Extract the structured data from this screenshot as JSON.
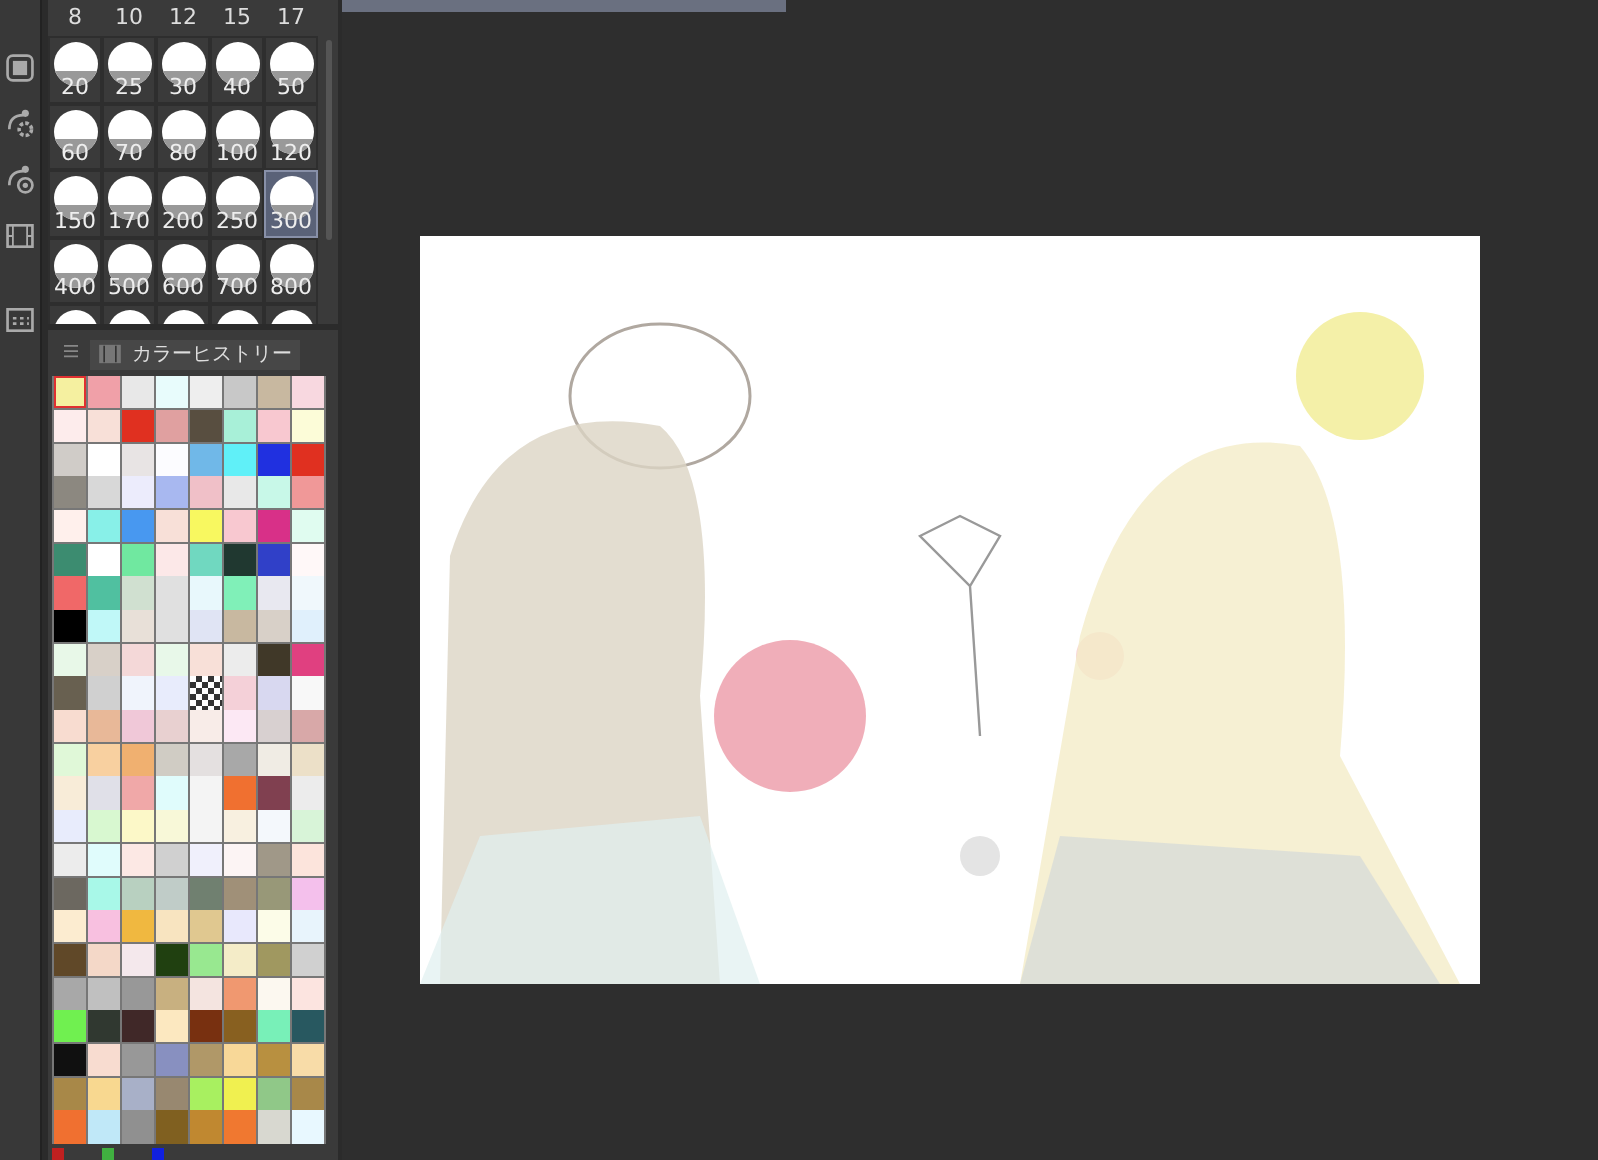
{
  "brush_sizes": {
    "top_row": [
      "8",
      "10",
      "12",
      "15",
      "17"
    ],
    "items": [
      {
        "label": "20",
        "selected": false
      },
      {
        "label": "25",
        "selected": false
      },
      {
        "label": "30",
        "selected": false
      },
      {
        "label": "40",
        "selected": false
      },
      {
        "label": "50",
        "selected": false
      },
      {
        "label": "60",
        "selected": false
      },
      {
        "label": "70",
        "selected": false
      },
      {
        "label": "80",
        "selected": false
      },
      {
        "label": "100",
        "selected": false
      },
      {
        "label": "120",
        "selected": false
      },
      {
        "label": "150",
        "selected": false
      },
      {
        "label": "170",
        "selected": false
      },
      {
        "label": "200",
        "selected": false
      },
      {
        "label": "250",
        "selected": false
      },
      {
        "label": "300",
        "selected": true
      },
      {
        "label": "400",
        "selected": false
      },
      {
        "label": "500",
        "selected": false
      },
      {
        "label": "600",
        "selected": false
      },
      {
        "label": "700",
        "selected": false
      },
      {
        "label": "800",
        "selected": false
      }
    ]
  },
  "color_history": {
    "tab": "カラーヒストリー",
    "rows": [
      [
        {
          "kind": "color",
          "color": "#f5f0a0",
          "selected": true
        },
        {
          "kind": "color",
          "color": "#f0a0a8",
          "selected": false
        },
        {
          "kind": "color",
          "color": "#e8e8e8",
          "selected": false
        },
        {
          "kind": "color",
          "color": "#e8fcfc",
          "selected": false
        },
        {
          "kind": "color",
          "color": "#eeeeee",
          "selected": false
        },
        {
          "kind": "color",
          "color": "#c8c8c8",
          "selected": false
        },
        {
          "kind": "color",
          "color": "#c8b8a0",
          "selected": false
        },
        {
          "kind": "color",
          "color": "#f8d8e0",
          "selected": false
        }
      ],
      [
        {
          "kind": "color",
          "color": "#fdecec",
          "selected": false
        },
        {
          "kind": "color",
          "color": "#f8e0d8",
          "selected": false
        },
        {
          "kind": "color",
          "color": "#e03020",
          "selected": false
        },
        {
          "kind": "color",
          "color": "#e0a0a0",
          "selected": false
        },
        {
          "kind": "color",
          "color": "#584e40",
          "selected": false
        },
        {
          "kind": "color",
          "color": "#a8f0d8",
          "selected": false
        },
        {
          "kind": "color",
          "color": "#f8c8d0",
          "selected": false
        },
        {
          "kind": "color",
          "color": "#fcfcd8",
          "selected": false
        }
      ],
      [
        {
          "kind": "color",
          "color": "#d0ccc8",
          "selected": false
        },
        {
          "kind": "color",
          "color": "#ffffff",
          "selected": false
        },
        {
          "kind": "color",
          "color": "#e8e4e4",
          "selected": false
        },
        {
          "kind": "color",
          "color": "#fcfcff",
          "selected": false
        },
        {
          "kind": "color",
          "color": "#70b8e8",
          "selected": false
        },
        {
          "kind": "color",
          "color": "#60f0f8",
          "selected": false
        },
        {
          "kind": "color",
          "color": "#2030e0",
          "selected": false
        },
        {
          "kind": "color",
          "color": "#e03020",
          "selected": false
        }
      ],
      [
        {
          "kind": "color",
          "color": "#8c8880",
          "selected": false
        },
        {
          "kind": "color",
          "color": "#d8d8d8",
          "selected": false
        },
        {
          "kind": "color",
          "color": "#ececfc",
          "selected": false
        },
        {
          "kind": "color",
          "color": "#a8b8f0",
          "selected": false
        },
        {
          "kind": "color",
          "color": "#f0c0c8",
          "selected": false
        },
        {
          "kind": "color",
          "color": "#e8e8e8",
          "selected": false
        },
        {
          "kind": "color",
          "color": "#c8f8e8",
          "selected": false
        },
        {
          "kind": "color",
          "color": "#f09898",
          "selected": false
        }
      ],
      [
        {
          "kind": "color",
          "color": "#fff0ec",
          "selected": false
        },
        {
          "kind": "color",
          "color": "#88f0e8",
          "selected": false
        },
        {
          "kind": "color",
          "color": "#4898f0",
          "selected": false
        },
        {
          "kind": "color",
          "color": "#f8e0d8",
          "selected": false
        },
        {
          "kind": "color",
          "color": "#f8f860",
          "selected": false
        },
        {
          "kind": "color",
          "color": "#f8c8d0",
          "selected": false
        },
        {
          "kind": "color",
          "color": "#d83088",
          "selected": false
        },
        {
          "kind": "color",
          "color": "#e0fcf0",
          "selected": false
        }
      ],
      [
        {
          "kind": "color",
          "color": "#3c8c70",
          "selected": false
        },
        {
          "kind": "color",
          "color": "#ffffff",
          "selected": false
        },
        {
          "kind": "color",
          "color": "#70e8a0",
          "selected": false
        },
        {
          "kind": "color",
          "color": "#fce8e8",
          "selected": false
        },
        {
          "kind": "color",
          "color": "#70d8c0",
          "selected": false
        },
        {
          "kind": "color",
          "color": "#203830",
          "selected": false
        },
        {
          "kind": "color",
          "color": "#3040c8",
          "selected": false
        },
        {
          "kind": "color",
          "color": "#fff8f8",
          "selected": false
        }
      ],
      [
        {
          "kind": "color",
          "color": "#f06868",
          "selected": false
        },
        {
          "kind": "color",
          "color": "#50c0a0",
          "selected": false
        },
        {
          "kind": "color",
          "color": "#d0e0d0",
          "selected": false
        },
        {
          "kind": "color",
          "color": "#e0e0e0",
          "selected": false
        },
        {
          "kind": "color",
          "color": "#e8f8fc",
          "selected": false
        },
        {
          "kind": "color",
          "color": "#80f0b8",
          "selected": false
        },
        {
          "kind": "color",
          "color": "#e8e8f0",
          "selected": false
        },
        {
          "kind": "color",
          "color": "#f0f8fc",
          "selected": false
        }
      ],
      [
        {
          "kind": "color",
          "color": "#000000",
          "selected": false
        },
        {
          "kind": "color",
          "color": "#c0f8f8",
          "selected": false
        },
        {
          "kind": "color",
          "color": "#e8e0d8",
          "selected": false
        },
        {
          "kind": "color",
          "color": "#e0e0e0",
          "selected": false
        },
        {
          "kind": "color",
          "color": "#e0e4f4",
          "selected": false
        },
        {
          "kind": "color",
          "color": "#c8b8a0",
          "selected": false
        },
        {
          "kind": "color",
          "color": "#d8d0c8",
          "selected": false
        },
        {
          "kind": "color",
          "color": "#e0f0fc",
          "selected": false
        }
      ],
      [
        {
          "kind": "color",
          "color": "#e8f8e8",
          "selected": false
        },
        {
          "kind": "color",
          "color": "#d8d0c8",
          "selected": false
        },
        {
          "kind": "color",
          "color": "#f4d8d8",
          "selected": false
        },
        {
          "kind": "color",
          "color": "#e8f8e9",
          "selected": false
        },
        {
          "kind": "color",
          "color": "#f8e0d8",
          "selected": false
        },
        {
          "kind": "color",
          "color": "#ececec",
          "selected": false
        },
        {
          "kind": "color",
          "color": "#403828",
          "selected": false
        },
        {
          "kind": "color",
          "color": "#e04080",
          "selected": false
        }
      ],
      [
        {
          "kind": "color",
          "color": "#686050",
          "selected": false
        },
        {
          "kind": "color",
          "color": "#d0d0d0",
          "selected": false
        },
        {
          "kind": "color",
          "color": "#f0f4fc",
          "selected": false
        },
        {
          "kind": "color",
          "color": "#e8ecfc",
          "selected": false
        },
        {
          "kind": "transparent",
          "selected": false
        },
        {
          "kind": "color",
          "color": "#f4d0d8",
          "selected": false
        },
        {
          "kind": "color",
          "color": "#d8d8f0",
          "selected": false
        },
        {
          "kind": "color",
          "color": "#f8f8f8",
          "selected": false
        }
      ],
      [
        {
          "kind": "color",
          "color": "#f8dcd0",
          "selected": false
        },
        {
          "kind": "color",
          "color": "#e8b898",
          "selected": false
        },
        {
          "kind": "color",
          "color": "#f0c8d8",
          "selected": false
        },
        {
          "kind": "color",
          "color": "#e8d0d0",
          "selected": false
        },
        {
          "kind": "color",
          "color": "#f8ece8",
          "selected": false
        },
        {
          "kind": "color",
          "color": "#fce8f4",
          "selected": false
        },
        {
          "kind": "color",
          "color": "#d8d0d0",
          "selected": false
        },
        {
          "kind": "color",
          "color": "#d8a8a8",
          "selected": false
        }
      ],
      [
        {
          "kind": "color",
          "color": "#e0f8d8",
          "selected": false
        },
        {
          "kind": "color",
          "color": "#f8d0a0",
          "selected": false
        },
        {
          "kind": "color",
          "color": "#f0b070",
          "selected": false
        },
        {
          "kind": "color",
          "color": "#d0ccc4",
          "selected": false
        },
        {
          "kind": "color",
          "color": "#e4e0e0",
          "selected": false
        },
        {
          "kind": "color",
          "color": "#a8a8a8",
          "selected": false
        },
        {
          "kind": "color",
          "color": "#f0ece4",
          "selected": false
        },
        {
          "kind": "color",
          "color": "#ece0c8",
          "selected": false
        }
      ],
      [
        {
          "kind": "color",
          "color": "#f8ecd8",
          "selected": false
        },
        {
          "kind": "color",
          "color": "#e0e0e8",
          "selected": false
        },
        {
          "kind": "color",
          "color": "#f0a8a8",
          "selected": false
        },
        {
          "kind": "color",
          "color": "#e0fcfc",
          "selected": false
        },
        {
          "kind": "color",
          "color": "#f4f4f4",
          "selected": false
        },
        {
          "kind": "color",
          "color": "#f07030",
          "selected": false
        },
        {
          "kind": "color",
          "color": "#804050",
          "selected": false
        },
        {
          "kind": "color",
          "color": "#ececec",
          "selected": false
        }
      ],
      [
        {
          "kind": "color",
          "color": "#e8ecfc",
          "selected": false
        },
        {
          "kind": "color",
          "color": "#d8f8d0",
          "selected": false
        },
        {
          "kind": "color",
          "color": "#fcf8c8",
          "selected": false
        },
        {
          "kind": "color",
          "color": "#f8f8d8",
          "selected": false
        },
        {
          "kind": "color",
          "color": "#f4f4f4",
          "selected": false
        },
        {
          "kind": "color",
          "color": "#f8f0e0",
          "selected": false
        },
        {
          "kind": "color",
          "color": "#f4f8fc",
          "selected": false
        },
        {
          "kind": "color",
          "color": "#d8f4d8",
          "selected": false
        }
      ],
      [
        {
          "kind": "color",
          "color": "#ececec",
          "selected": false
        },
        {
          "kind": "color",
          "color": "#e0fcfc",
          "selected": false
        },
        {
          "kind": "color",
          "color": "#fce8e4",
          "selected": false
        },
        {
          "kind": "color",
          "color": "#d0d0d0",
          "selected": false
        },
        {
          "kind": "color",
          "color": "#f0f0fc",
          "selected": false
        },
        {
          "kind": "color",
          "color": "#fcf4f4",
          "selected": false
        },
        {
          "kind": "color",
          "color": "#a09888",
          "selected": false
        },
        {
          "kind": "color",
          "color": "#fce4dc",
          "selected": false
        }
      ],
      [
        {
          "kind": "color",
          "color": "#6c6860",
          "selected": false
        },
        {
          "kind": "color",
          "color": "#a8f8e8",
          "selected": false
        },
        {
          "kind": "color",
          "color": "#b8d0c0",
          "selected": false
        },
        {
          "kind": "color",
          "color": "#c0ccc8",
          "selected": false
        },
        {
          "kind": "color",
          "color": "#708070",
          "selected": false
        },
        {
          "kind": "color",
          "color": "#a09078",
          "selected": false
        },
        {
          "kind": "color",
          "color": "#989878",
          "selected": false
        },
        {
          "kind": "color",
          "color": "#f4c0ec",
          "selected": false
        }
      ],
      [
        {
          "kind": "color",
          "color": "#fcecd0",
          "selected": false
        },
        {
          "kind": "color",
          "color": "#f8c0e0",
          "selected": false
        },
        {
          "kind": "color",
          "color": "#f0b840",
          "selected": false
        },
        {
          "kind": "color",
          "color": "#f8e4c0",
          "selected": false
        },
        {
          "kind": "color",
          "color": "#e0c890",
          "selected": false
        },
        {
          "kind": "color",
          "color": "#e8e8fc",
          "selected": false
        },
        {
          "kind": "color",
          "color": "#fcfce8",
          "selected": false
        },
        {
          "kind": "color",
          "color": "#e8f4fc",
          "selected": false
        }
      ],
      [
        {
          "kind": "color",
          "color": "#604828",
          "selected": false
        },
        {
          "kind": "color",
          "color": "#f4d8c8",
          "selected": false
        },
        {
          "kind": "color",
          "color": "#f4e8ec",
          "selected": false
        },
        {
          "kind": "color",
          "color": "#204010",
          "selected": false
        },
        {
          "kind": "color",
          "color": "#98e890",
          "selected": false
        },
        {
          "kind": "color",
          "color": "#f4ecc8",
          "selected": false
        },
        {
          "kind": "color",
          "color": "#a09860",
          "selected": false
        },
        {
          "kind": "color",
          "color": "#d0d0d0",
          "selected": false
        }
      ],
      [
        {
          "kind": "color",
          "color": "#a8a8a8",
          "selected": false
        },
        {
          "kind": "color",
          "color": "#c0c0c0",
          "selected": false
        },
        {
          "kind": "color",
          "color": "#989898",
          "selected": false
        },
        {
          "kind": "color",
          "color": "#c8b080",
          "selected": false
        },
        {
          "kind": "color",
          "color": "#f4e4e0",
          "selected": false
        },
        {
          "kind": "color",
          "color": "#f09870",
          "selected": false
        },
        {
          "kind": "color",
          "color": "#fcf8f0",
          "selected": false
        },
        {
          "kind": "color",
          "color": "#fce4e0",
          "selected": false
        }
      ],
      [
        {
          "kind": "color",
          "color": "#70f050",
          "selected": false
        },
        {
          "kind": "color",
          "color": "#303830",
          "selected": false
        },
        {
          "kind": "color",
          "color": "#402828",
          "selected": false
        },
        {
          "kind": "color",
          "color": "#fce8c0",
          "selected": false
        },
        {
          "kind": "color",
          "color": "#783010",
          "selected": false
        },
        {
          "kind": "color",
          "color": "#886020",
          "selected": false
        },
        {
          "kind": "color",
          "color": "#78f0b8",
          "selected": false
        },
        {
          "kind": "color",
          "color": "#285860",
          "selected": false
        }
      ],
      [
        {
          "kind": "color",
          "color": "#101010",
          "selected": false
        },
        {
          "kind": "color",
          "color": "#f8dcd0",
          "selected": false
        },
        {
          "kind": "color",
          "color": "#989898",
          "selected": false
        },
        {
          "kind": "color",
          "color": "#8890c0",
          "selected": false
        },
        {
          "kind": "color",
          "color": "#b09868",
          "selected": false
        },
        {
          "kind": "color",
          "color": "#f8d898",
          "selected": false
        },
        {
          "kind": "color",
          "color": "#b89040",
          "selected": false
        },
        {
          "kind": "color",
          "color": "#f8dca8",
          "selected": false
        }
      ],
      [
        {
          "kind": "color",
          "color": "#a88848",
          "selected": false
        },
        {
          "kind": "color",
          "color": "#f8d890",
          "selected": false
        },
        {
          "kind": "color",
          "color": "#a8b0c8",
          "selected": false
        },
        {
          "kind": "color",
          "color": "#988870",
          "selected": false
        },
        {
          "kind": "color",
          "color": "#a8f060",
          "selected": false
        },
        {
          "kind": "color",
          "color": "#f0f050",
          "selected": false
        },
        {
          "kind": "color",
          "color": "#90c888",
          "selected": false
        },
        {
          "kind": "color",
          "color": "#a88849",
          "selected": false
        }
      ],
      [
        {
          "kind": "color",
          "color": "#f07030",
          "selected": false
        },
        {
          "kind": "color",
          "color": "#c0e8f8",
          "selected": false
        },
        {
          "kind": "color",
          "color": "#909090",
          "selected": false
        },
        {
          "kind": "color",
          "color": "#806020",
          "selected": false
        },
        {
          "kind": "color",
          "color": "#c08830",
          "selected": false
        },
        {
          "kind": "color",
          "color": "#f07830",
          "selected": false
        },
        {
          "kind": "color",
          "color": "#d8d8d0",
          "selected": false
        },
        {
          "kind": "color",
          "color": "#e8f8ff",
          "selected": false
        }
      ]
    ],
    "channels": [
      {
        "color": "#c02020"
      },
      {
        "color": "#40b040"
      },
      {
        "color": "#1020e0"
      }
    ]
  }
}
